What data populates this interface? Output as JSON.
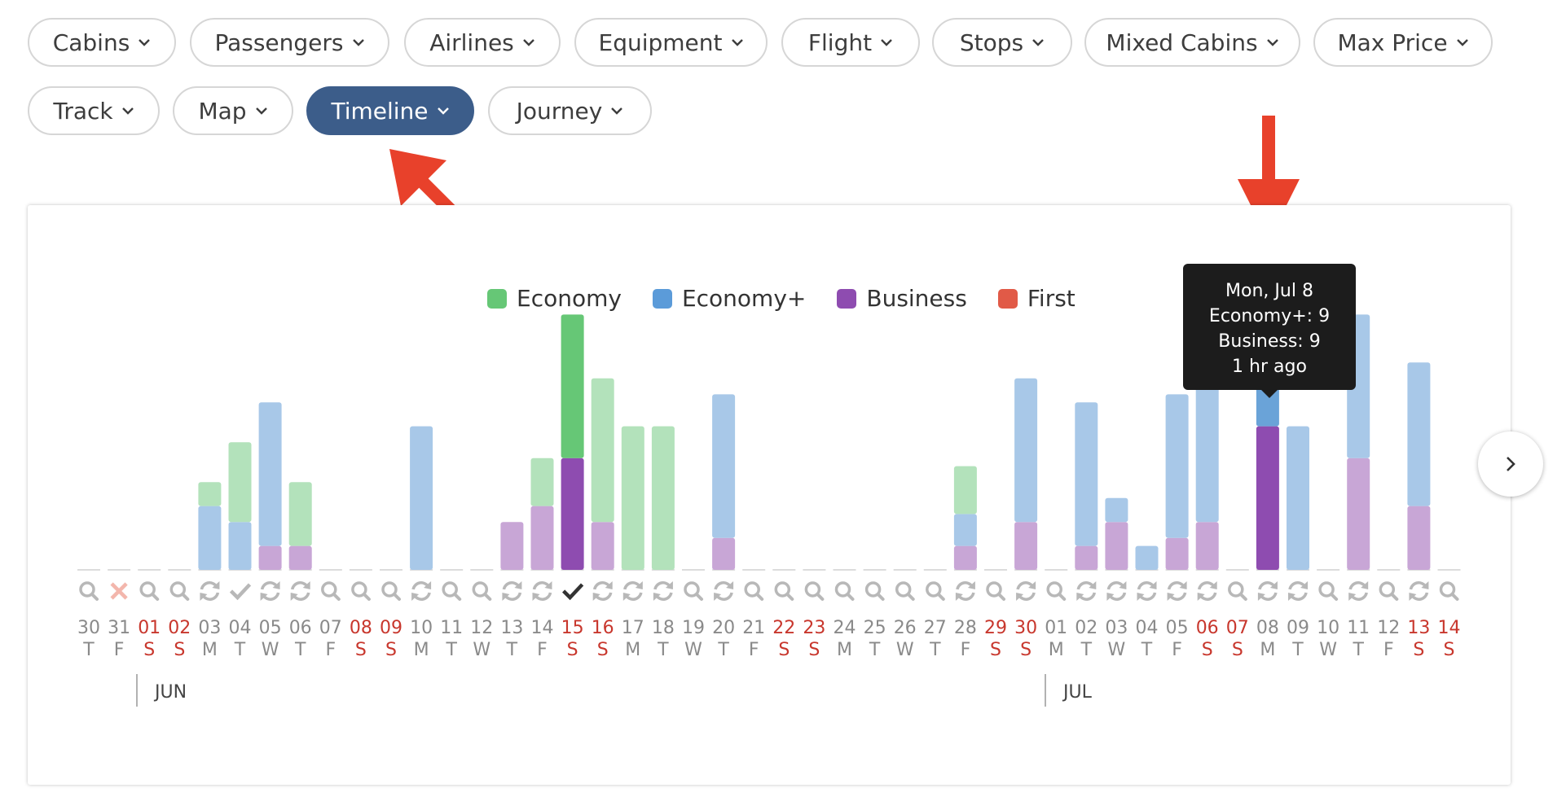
{
  "filters": {
    "row1": [
      {
        "label": "Cabins"
      },
      {
        "label": "Passengers"
      },
      {
        "label": "Airlines"
      },
      {
        "label": "Equipment"
      },
      {
        "label": "Flight"
      },
      {
        "label": "Stops"
      },
      {
        "label": "Mixed Cabins"
      },
      {
        "label": "Max Price"
      }
    ],
    "row2": [
      {
        "label": "Track"
      },
      {
        "label": "Map"
      },
      {
        "label": "Timeline",
        "active": true
      },
      {
        "label": "Journey"
      }
    ]
  },
  "legend": [
    {
      "label": "Economy",
      "color": "#66c776"
    },
    {
      "label": "Economy+",
      "color": "#5b9bd9"
    },
    {
      "label": "Business",
      "color": "#8e4cb0"
    },
    {
      "label": "First",
      "color": "#e15a47"
    }
  ],
  "tooltip": {
    "date": "Mon, Jul 8",
    "line1": "Economy+: 9",
    "line2": "Business: 9",
    "line3": "1 hr ago"
  },
  "months": [
    {
      "label": "JUN",
      "start_index": 2
    },
    {
      "label": "JUL",
      "start_index": 32
    }
  ],
  "chart_data": {
    "type": "bar",
    "stacked": true,
    "series_order": [
      "Business",
      "Economy+",
      "Economy"
    ],
    "days": [
      {
        "d": "30",
        "w": "T",
        "weekend": false,
        "status": "search",
        "business": 0,
        "economy_plus": 0,
        "economy": 0
      },
      {
        "d": "31",
        "w": "F",
        "weekend": false,
        "status": "error",
        "business": 0,
        "economy_plus": 0,
        "economy": 0
      },
      {
        "d": "01",
        "w": "S",
        "weekend": true,
        "status": "search",
        "business": 0,
        "economy_plus": 0,
        "economy": 0
      },
      {
        "d": "02",
        "w": "S",
        "weekend": true,
        "status": "search",
        "business": 0,
        "economy_plus": 0,
        "economy": 0
      },
      {
        "d": "03",
        "w": "M",
        "weekend": false,
        "status": "refresh",
        "business": 0,
        "economy_plus": 4,
        "economy": 1.5
      },
      {
        "d": "04",
        "w": "T",
        "weekend": false,
        "status": "check",
        "business": 0,
        "economy_plus": 3,
        "economy": 5
      },
      {
        "d": "05",
        "w": "W",
        "weekend": false,
        "status": "refresh",
        "business": 1.5,
        "economy_plus": 9,
        "economy": 0
      },
      {
        "d": "06",
        "w": "T",
        "weekend": false,
        "status": "refresh",
        "business": 1.5,
        "economy_plus": 0,
        "economy": 4
      },
      {
        "d": "07",
        "w": "F",
        "weekend": false,
        "status": "search",
        "business": 0,
        "economy_plus": 0,
        "economy": 0
      },
      {
        "d": "08",
        "w": "S",
        "weekend": true,
        "status": "search",
        "business": 0,
        "economy_plus": 0,
        "economy": 0
      },
      {
        "d": "09",
        "w": "S",
        "weekend": true,
        "status": "search",
        "business": 0,
        "economy_plus": 0,
        "economy": 0
      },
      {
        "d": "10",
        "w": "M",
        "weekend": false,
        "status": "refresh",
        "business": 0,
        "economy_plus": 9,
        "economy": 0
      },
      {
        "d": "11",
        "w": "T",
        "weekend": false,
        "status": "search",
        "business": 0,
        "economy_plus": 0,
        "economy": 0
      },
      {
        "d": "12",
        "w": "W",
        "weekend": false,
        "status": "search",
        "business": 0,
        "economy_plus": 0,
        "economy": 0
      },
      {
        "d": "13",
        "w": "T",
        "weekend": false,
        "status": "refresh",
        "business": 3,
        "economy_plus": 0,
        "economy": 0
      },
      {
        "d": "14",
        "w": "F",
        "weekend": false,
        "status": "refresh",
        "business": 4,
        "economy_plus": 0,
        "economy": 3
      },
      {
        "d": "15",
        "w": "S",
        "weekend": true,
        "status": "check",
        "business": 7,
        "economy_plus": 0,
        "economy": 9,
        "highlight": true
      },
      {
        "d": "16",
        "w": "S",
        "weekend": true,
        "status": "refresh",
        "business": 3,
        "economy_plus": 0,
        "economy": 9
      },
      {
        "d": "17",
        "w": "M",
        "weekend": false,
        "status": "refresh",
        "business": 0,
        "economy_plus": 0,
        "economy": 9
      },
      {
        "d": "18",
        "w": "T",
        "weekend": false,
        "status": "refresh",
        "business": 0,
        "economy_plus": 0,
        "economy": 9
      },
      {
        "d": "19",
        "w": "W",
        "weekend": false,
        "status": "search",
        "business": 0,
        "economy_plus": 0,
        "economy": 0
      },
      {
        "d": "20",
        "w": "T",
        "weekend": false,
        "status": "refresh",
        "business": 2,
        "economy_plus": 9,
        "economy": 0
      },
      {
        "d": "21",
        "w": "F",
        "weekend": false,
        "status": "search",
        "business": 0,
        "economy_plus": 0,
        "economy": 0
      },
      {
        "d": "22",
        "w": "S",
        "weekend": true,
        "status": "search",
        "business": 0,
        "economy_plus": 0,
        "economy": 0
      },
      {
        "d": "23",
        "w": "S",
        "weekend": true,
        "status": "search",
        "business": 0,
        "economy_plus": 0,
        "economy": 0
      },
      {
        "d": "24",
        "w": "M",
        "weekend": false,
        "status": "search",
        "business": 0,
        "economy_plus": 0,
        "economy": 0
      },
      {
        "d": "25",
        "w": "T",
        "weekend": false,
        "status": "search",
        "business": 0,
        "economy_plus": 0,
        "economy": 0
      },
      {
        "d": "26",
        "w": "W",
        "weekend": false,
        "status": "search",
        "business": 0,
        "economy_plus": 0,
        "economy": 0
      },
      {
        "d": "27",
        "w": "T",
        "weekend": false,
        "status": "search",
        "business": 0,
        "economy_plus": 0,
        "economy": 0
      },
      {
        "d": "28",
        "w": "F",
        "weekend": false,
        "status": "refresh",
        "business": 1.5,
        "economy_plus": 2,
        "economy": 3
      },
      {
        "d": "29",
        "w": "S",
        "weekend": true,
        "status": "search",
        "business": 0,
        "economy_plus": 0,
        "economy": 0
      },
      {
        "d": "30",
        "w": "S",
        "weekend": true,
        "status": "refresh",
        "business": 3,
        "economy_plus": 9,
        "economy": 0
      },
      {
        "d": "01",
        "w": "M",
        "weekend": false,
        "status": "search",
        "business": 0,
        "economy_plus": 0,
        "economy": 0
      },
      {
        "d": "02",
        "w": "T",
        "weekend": false,
        "status": "refresh",
        "business": 1.5,
        "economy_plus": 9,
        "economy": 0
      },
      {
        "d": "03",
        "w": "W",
        "weekend": false,
        "status": "refresh",
        "business": 3,
        "economy_plus": 1.5,
        "economy": 0
      },
      {
        "d": "04",
        "w": "T",
        "weekend": false,
        "status": "refresh",
        "business": 0,
        "economy_plus": 1.5,
        "economy": 0
      },
      {
        "d": "05",
        "w": "F",
        "weekend": false,
        "status": "refresh",
        "business": 2,
        "economy_plus": 9,
        "economy": 0
      },
      {
        "d": "06",
        "w": "S",
        "weekend": true,
        "status": "refresh",
        "business": 3,
        "economy_plus": 9,
        "economy": 0
      },
      {
        "d": "07",
        "w": "S",
        "weekend": true,
        "status": "search",
        "business": 0,
        "economy_plus": 0,
        "economy": 0
      },
      {
        "d": "08",
        "w": "M",
        "weekend": false,
        "status": "refresh",
        "business": 9,
        "economy_plus": 9,
        "economy": 0,
        "highlight": true
      },
      {
        "d": "09",
        "w": "T",
        "weekend": false,
        "status": "refresh",
        "business": 0,
        "economy_plus": 9,
        "economy": 0
      },
      {
        "d": "10",
        "w": "W",
        "weekend": false,
        "status": "search",
        "business": 0,
        "economy_plus": 0,
        "economy": 0
      },
      {
        "d": "11",
        "w": "T",
        "weekend": false,
        "status": "refresh",
        "business": 7,
        "economy_plus": 9,
        "economy": 0
      },
      {
        "d": "12",
        "w": "F",
        "weekend": false,
        "status": "search",
        "business": 0,
        "economy_plus": 0,
        "economy": 0
      },
      {
        "d": "13",
        "w": "S",
        "weekend": true,
        "status": "refresh",
        "business": 4,
        "economy_plus": 9,
        "economy": 0
      },
      {
        "d": "14",
        "w": "S",
        "weekend": true,
        "status": "search",
        "business": 0,
        "economy_plus": 0,
        "economy": 0
      }
    ]
  }
}
